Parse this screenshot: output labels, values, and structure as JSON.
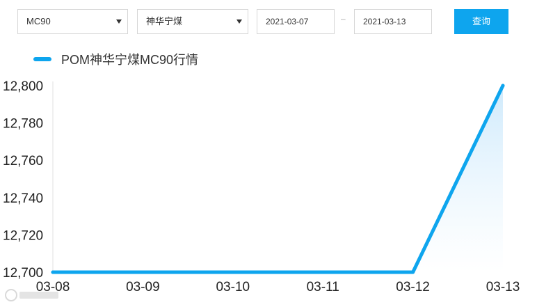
{
  "filters": {
    "product_select": "MC90",
    "origin_select": "神华宁煤",
    "start_date": "2021-03-07",
    "range_separator": "–",
    "end_date": "2021-03-13",
    "query_button": "查询"
  },
  "colors": {
    "accent": "#0ea5ee",
    "line": "#0ea5ee",
    "area_fill_top": "#cfeafc",
    "axis": "#dddddd"
  },
  "icons": {
    "select_caret": "chevron-down-icon"
  },
  "chart_data": {
    "type": "area",
    "title": "",
    "xlabel": "",
    "ylabel": "",
    "x": [
      "03-08",
      "03-09",
      "03-10",
      "03-11",
      "03-12",
      "03-13"
    ],
    "series": [
      {
        "name": "POM神华宁煤MC90行情",
        "values": [
          12700,
          12700,
          12700,
          12700,
          12700,
          12800
        ]
      }
    ],
    "ylim": [
      12700,
      12800
    ],
    "yticks": [
      "12,700",
      "12,720",
      "12,740",
      "12,760",
      "12,780",
      "12,800"
    ],
    "grid": false,
    "legend_position": "top-left"
  }
}
